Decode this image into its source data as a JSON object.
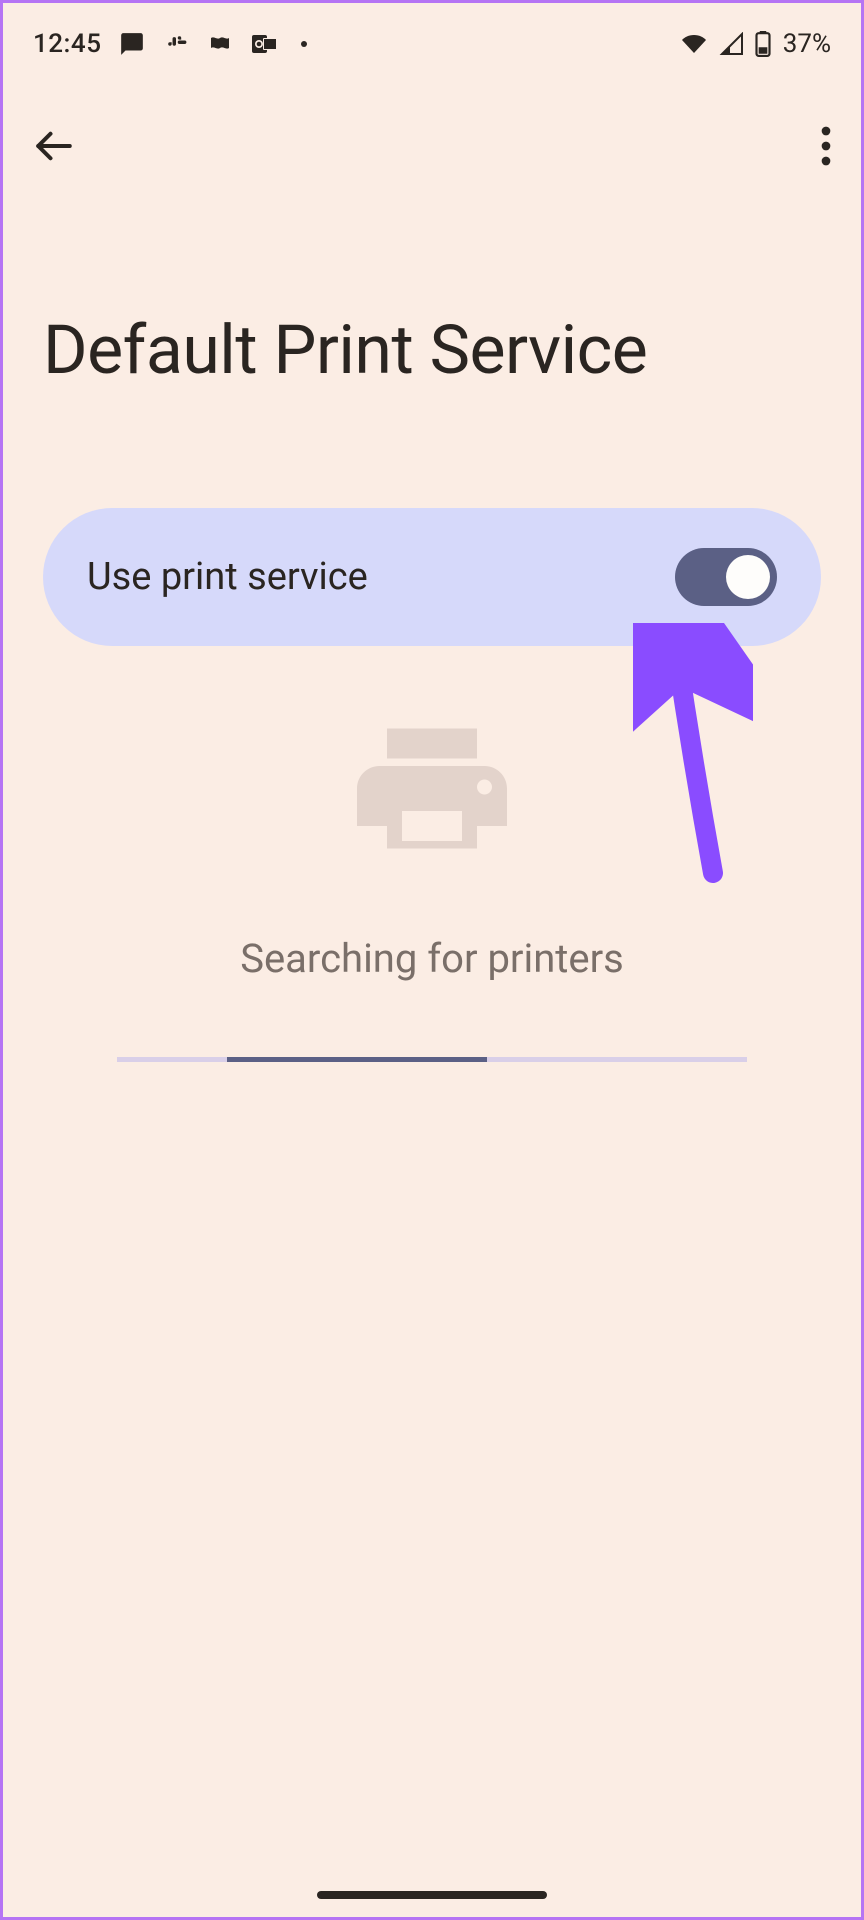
{
  "status_bar": {
    "time": "12:45",
    "battery": "37%"
  },
  "header": {
    "title": "Default Print Service"
  },
  "toggle": {
    "label": "Use print service",
    "enabled": true
  },
  "content": {
    "status_text": "Searching for printers"
  }
}
